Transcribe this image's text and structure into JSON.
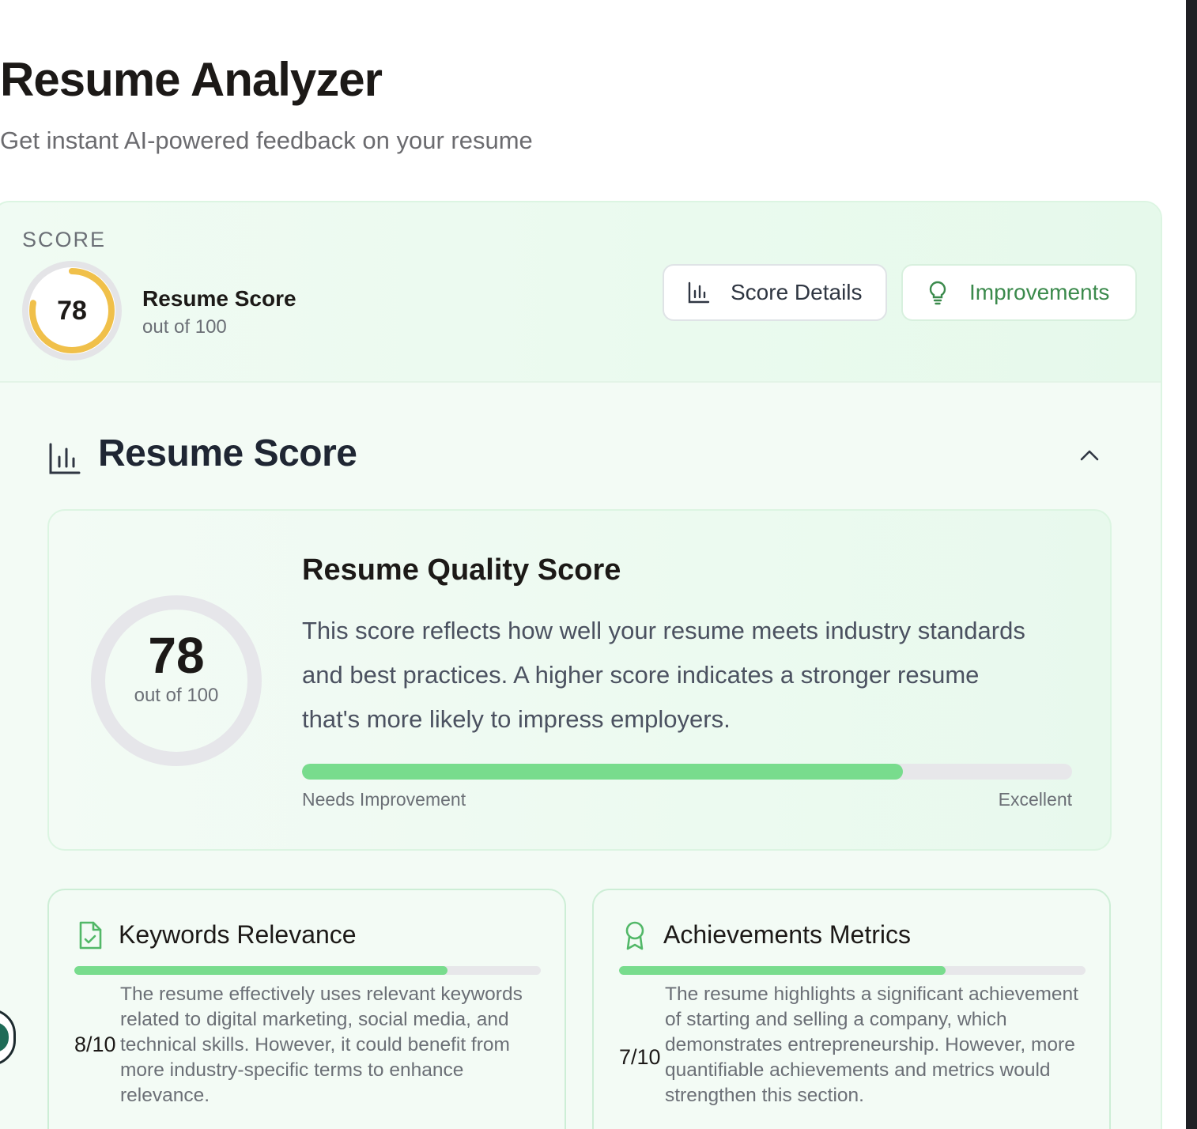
{
  "header": {
    "title": "Resume Analyzer",
    "subtitle": "Get instant AI-powered feedback on your resume"
  },
  "summary": {
    "eyebrow": "SCORE",
    "score": 78,
    "score_text": "78",
    "title": "Resume Score",
    "subtitle": "out of 100",
    "ring_color": "#f0c04a"
  },
  "buttons": {
    "score_details": {
      "label": "Score Details",
      "icon": "bar-chart-icon"
    },
    "improvements": {
      "label": "Improvements",
      "icon": "lightbulb-icon"
    }
  },
  "section": {
    "title": "Resume Score",
    "icon": "bar-chart-icon",
    "collapse_icon": "chevron-up-icon"
  },
  "quality": {
    "score": 78,
    "score_text": "78",
    "score_sub": "out of 100",
    "title": "Resume Quality Score",
    "description": "This score reflects how well your resume meets industry standards and best practices. A higher score indicates a stronger resume that's more likely to impress employers.",
    "progress_fraction": 0.78,
    "low_label": "Needs Improvement",
    "high_label": "Excellent",
    "accent": "#78dc8d"
  },
  "metrics": [
    {
      "title": "Keywords Relevance",
      "icon": "file-check-icon",
      "score_text": "8/10",
      "fraction": 0.8,
      "description": "The resume effectively uses relevant keywords related to digital marketing, social media, and technical skills. However, it could benefit from more industry-specific terms to enhance relevance."
    },
    {
      "title": "Achievements Metrics",
      "icon": "award-icon",
      "score_text": "7/10",
      "fraction": 0.7,
      "description": "The resume highlights a significant achievement of starting and selling a company, which demonstrates entrepreneurship. However, more quantifiable achievements and metrics would strengthen this section."
    }
  ]
}
